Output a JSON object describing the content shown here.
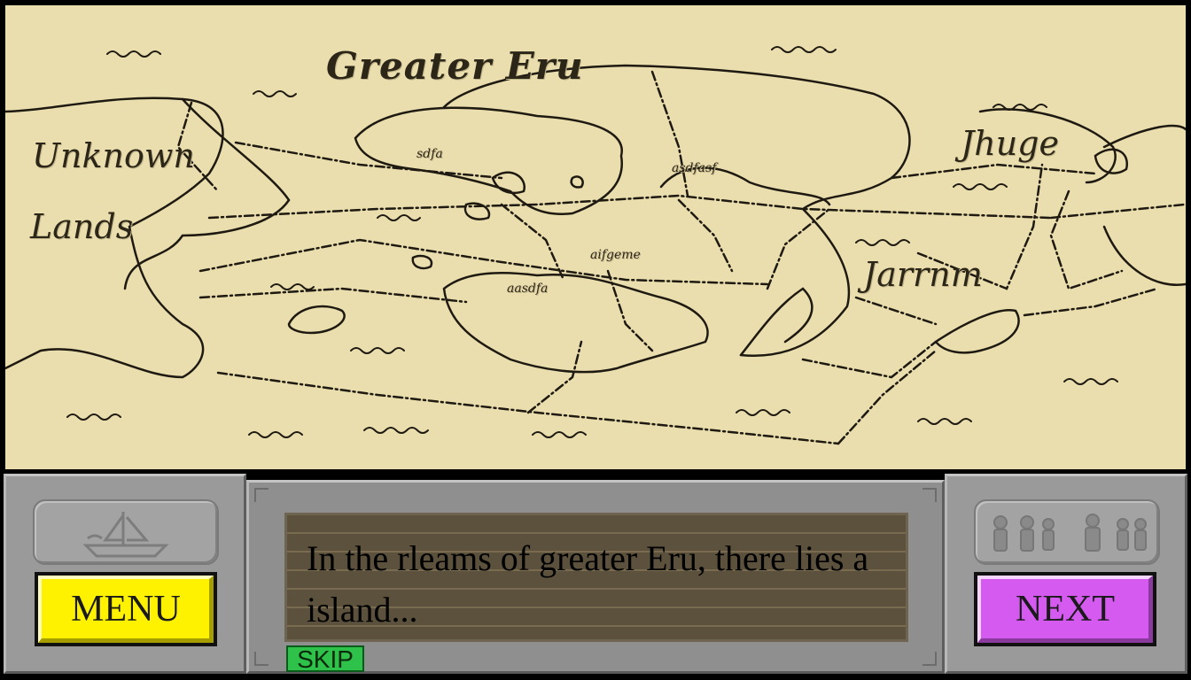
{
  "map": {
    "regions": {
      "greater_eru": "Greater Eru",
      "unknown": "Unknown",
      "lands": "Lands",
      "jhuge": "Jhuge",
      "jarrnm": "Jarrnm"
    },
    "towns": {
      "t1": "sdfa",
      "t2": "asdfasf",
      "t3": "aifgeme",
      "t4": "aasdfa"
    }
  },
  "dialog": {
    "text": "In the rleams of greater Eru, there lies a island..."
  },
  "buttons": {
    "menu": "MENU",
    "next": "NEXT",
    "skip": "SKIP"
  },
  "colors": {
    "parchment": "#ebdeae",
    "ink": "#1e1a12",
    "menu_button": "#fff200",
    "next_button": "#d45af0",
    "skip_button": "#2fc24a",
    "stone": "#9a9a9a",
    "dialog_bg": "#5c513c"
  },
  "icons": {
    "left_emblem": "ship-icon",
    "right_emblem": "party-icon"
  }
}
